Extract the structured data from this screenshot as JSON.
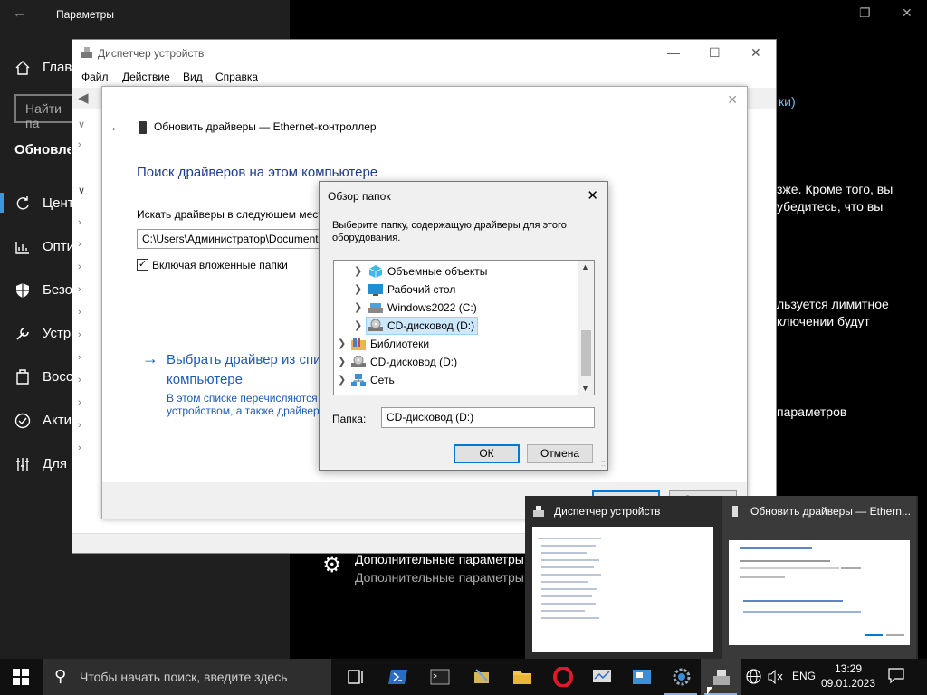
{
  "settings": {
    "title": "Параметры",
    "nav_home": "Главная",
    "search_placeholder": "Найти па",
    "section_heading": "Обновление и безопасность",
    "nav": [
      "Центр обновления",
      "Оптимизация",
      "Безопасность",
      "Устранение",
      "Восстановление",
      "Активация",
      "Для разработчиков"
    ],
    "right_link": "ки)",
    "right_text1a": "зже. Кроме того, вы",
    "right_text1b": "убедитесь, что вы",
    "right_text2a": "льзуется лимитное",
    "right_text2b": "ключении будут",
    "right_text3": "параметров",
    "adv_title": "Дополнительные параметры",
    "adv_sub": "Дополнительные параметры и з"
  },
  "devmgr": {
    "title": "Диспетчер устройств",
    "menu": [
      "Файл",
      "Действие",
      "Вид",
      "Справка"
    ]
  },
  "update": {
    "header": "Обновить драйверы — Ethernet-контроллер",
    "h1": "Поиск драйверов на этом компьютере",
    "search_label": "Искать драйверы в следующем мест",
    "path_value": "C:\\Users\\Администратор\\Document",
    "include_subfolders": "Включая вложенные папки",
    "pick_line1": "Выбрать драйвер из спи",
    "pick_line2": "компьютере",
    "pick_desc1": "В этом списке перечисляются",
    "pick_desc2": "устройством, а также драйвер",
    "next_btn": "Далее",
    "cancel_btn": "Отмена"
  },
  "browse": {
    "title": "Обзор папок",
    "description": "Выберите папку, содержащую драйверы для этого оборудования.",
    "tree": [
      {
        "label": "Объемные объекты",
        "icon": "3d-objects-icon",
        "level": 2
      },
      {
        "label": "Рабочий стол",
        "icon": "desktop-icon",
        "level": 2
      },
      {
        "label": "Windows2022 (C:)",
        "icon": "drive-icon",
        "level": 2
      },
      {
        "label": "CD-дисковод (D:)",
        "icon": "cd-drive-icon",
        "level": 2,
        "selected": true
      },
      {
        "label": "Библиотеки",
        "icon": "libraries-icon",
        "level": 1
      },
      {
        "label": "CD-дисковод (D:)",
        "icon": "cd-drive-icon",
        "level": 1
      },
      {
        "label": "Сеть",
        "icon": "network-icon",
        "level": 1
      }
    ],
    "folder_label": "Папка:",
    "folder_value": "CD-дисковод (D:)",
    "ok": "ОК",
    "cancel": "Отмена"
  },
  "preview": {
    "item1": "Диспетчер устройств",
    "item2": "Обновить драйверы — Ethern..."
  },
  "taskbar": {
    "search_placeholder": "Чтобы начать поиск, введите здесь",
    "lang": "ENG",
    "time": "13:29",
    "date": "09.01.2023"
  },
  "colors": {
    "accent": "#0078d7",
    "link_blue": "#1e5cb3",
    "heading_blue": "#1e3c8c"
  }
}
